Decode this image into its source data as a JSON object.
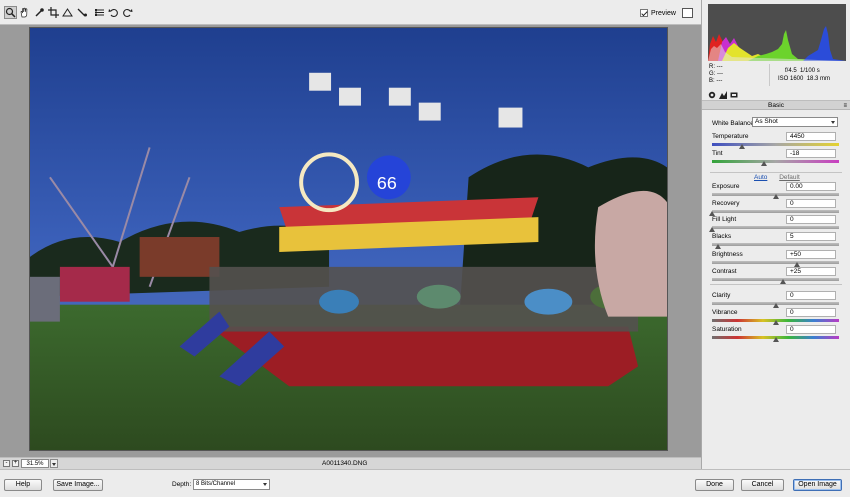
{
  "toolbar": {
    "tools": [
      "zoom-tool-icon",
      "hand-tool-icon",
      "white-balance-tool-icon",
      "crop-tool-icon",
      "straighten-tool-icon",
      "retouch-tool-icon",
      "preferences-icon",
      "rotate-left-icon",
      "rotate-right-icon"
    ],
    "preview_label": "Preview",
    "preview_checked": true
  },
  "status": {
    "zoom_minus": "-",
    "zoom_plus": "+",
    "zoom_value": "31.5%",
    "filename": "A0011340.DNG"
  },
  "bottom": {
    "help_label": "Help",
    "save_label": "Save Image...",
    "depth_label": "Depth:",
    "depth_value": "8 Bits/Channel",
    "done_label": "Done",
    "cancel_label": "Cancel",
    "open_label": "Open Image"
  },
  "readout": {
    "r_label": "R:",
    "r_value": "---",
    "g_label": "G:",
    "g_value": "---",
    "b_label": "B:",
    "b_value": "---",
    "aperture": "f/4.5",
    "shutter": "1/100 s",
    "iso": "ISO 1600",
    "focal": "18.3 mm"
  },
  "panel": {
    "section_title": "Basic",
    "white_balance_label": "White Balance:",
    "white_balance_value": "As Shot",
    "auto_label": "Auto",
    "default_label": "Default",
    "sliders": [
      {
        "label": "Temperature",
        "value": "4450",
        "fraction": 0.24,
        "track": "temp"
      },
      {
        "label": "Tint",
        "value": "-18",
        "fraction": 0.41,
        "track": "tint"
      },
      {
        "label": "Exposure",
        "value": "0.00",
        "fraction": 0.5,
        "track": "grey"
      },
      {
        "label": "Recovery",
        "value": "0",
        "fraction": 0.0,
        "track": "grey"
      },
      {
        "label": "Fill Light",
        "value": "0",
        "fraction": 0.0,
        "track": "grey"
      },
      {
        "label": "Blacks",
        "value": "5",
        "fraction": 0.05,
        "track": "grey"
      },
      {
        "label": "Brightness",
        "value": "+50",
        "fraction": 0.67,
        "track": "grey"
      },
      {
        "label": "Contrast",
        "value": "+25",
        "fraction": 0.56,
        "track": "grey"
      },
      {
        "label": "Clarity",
        "value": "0",
        "fraction": 0.5,
        "track": "grey"
      },
      {
        "label": "Vibrance",
        "value": "0",
        "fraction": 0.5,
        "track": "sat"
      },
      {
        "label": "Saturation",
        "value": "0",
        "fraction": 0.5,
        "track": "sat"
      }
    ]
  },
  "colors": {
    "accent": "#3f6fb5",
    "panel_bg": "#ececec",
    "canvas_bg": "#9b9b9b"
  }
}
